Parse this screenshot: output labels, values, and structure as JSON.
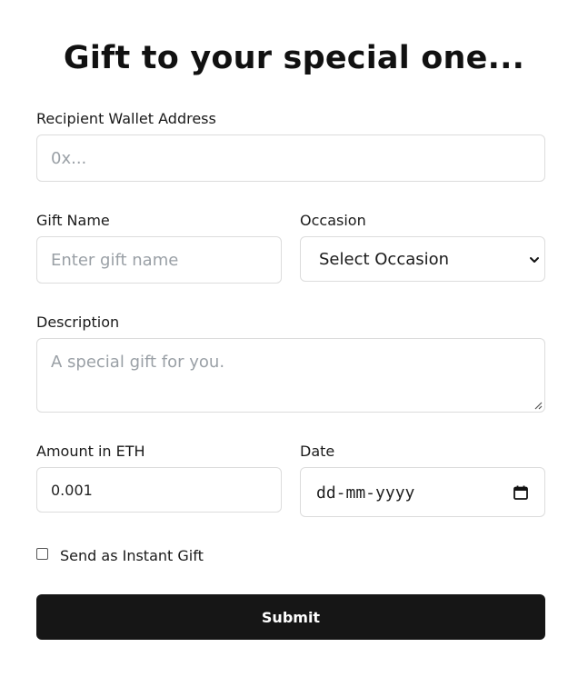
{
  "title": "Gift to your special one...",
  "recipient": {
    "label": "Recipient Wallet Address",
    "placeholder": "0x..."
  },
  "gift_name": {
    "label": "Gift Name",
    "placeholder": "Enter gift name"
  },
  "occasion": {
    "label": "Occasion",
    "selected": "Select Occasion",
    "icon": "chevron-down-icon"
  },
  "description": {
    "label": "Description",
    "placeholder": "A special gift for you.",
    "icon": "resize-handle-icon"
  },
  "amount": {
    "label": "Amount in ETH",
    "value": "0.001"
  },
  "date": {
    "label": "Date",
    "placeholder": "dd-mm-yyyy",
    "icon": "calendar-icon"
  },
  "instant_gift": {
    "label": "Send as Instant Gift",
    "checked": false
  },
  "submit": {
    "label": "Submit"
  },
  "colors": {
    "button_bg": "#161616",
    "border": "#dcdcdc",
    "placeholder": "#9aa0a6"
  }
}
